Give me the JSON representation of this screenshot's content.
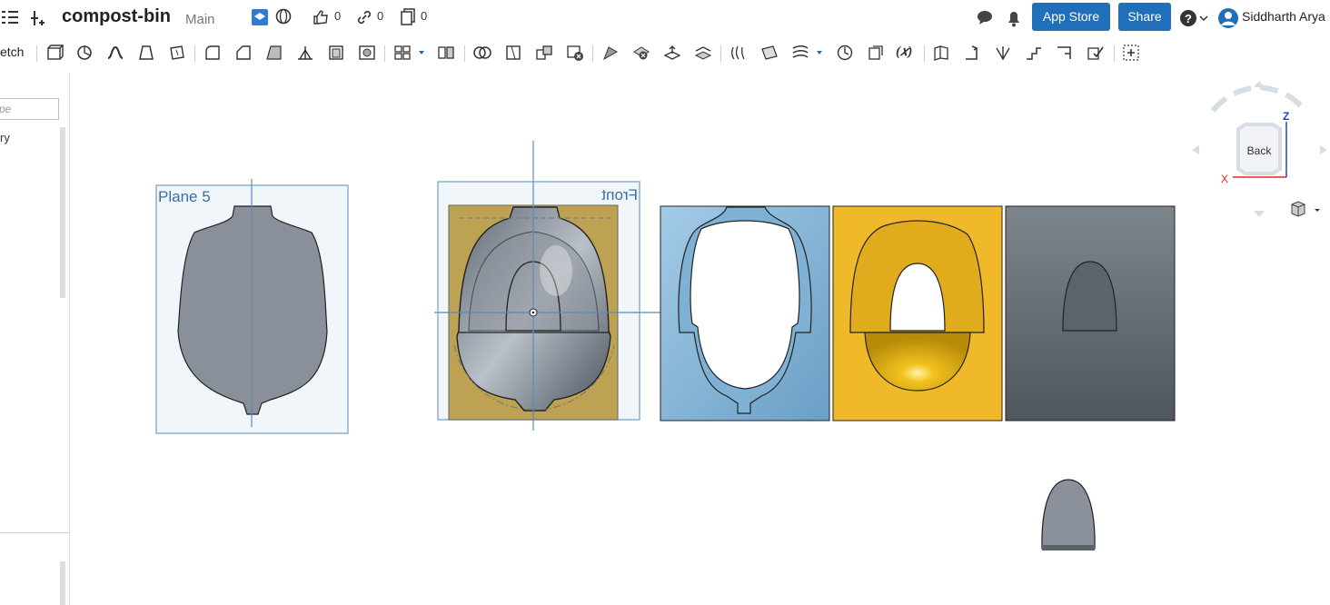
{
  "document": {
    "title": "compost-bin",
    "branch": "Main"
  },
  "social": {
    "likes": "0",
    "links": "0",
    "copies": "0"
  },
  "header": {
    "app_store": "App Store",
    "share": "Share",
    "user": "Siddharth Arya"
  },
  "toolbar": {
    "sketch_label": "etch"
  },
  "sidebar": {
    "filter_placeholder": "pe",
    "history_label": "ry"
  },
  "viewport": {
    "plane_label": "Plane 5",
    "front_label": "Front"
  },
  "view_cube": {
    "face": "Back",
    "axis_z": "Z",
    "axis_x": "X"
  }
}
